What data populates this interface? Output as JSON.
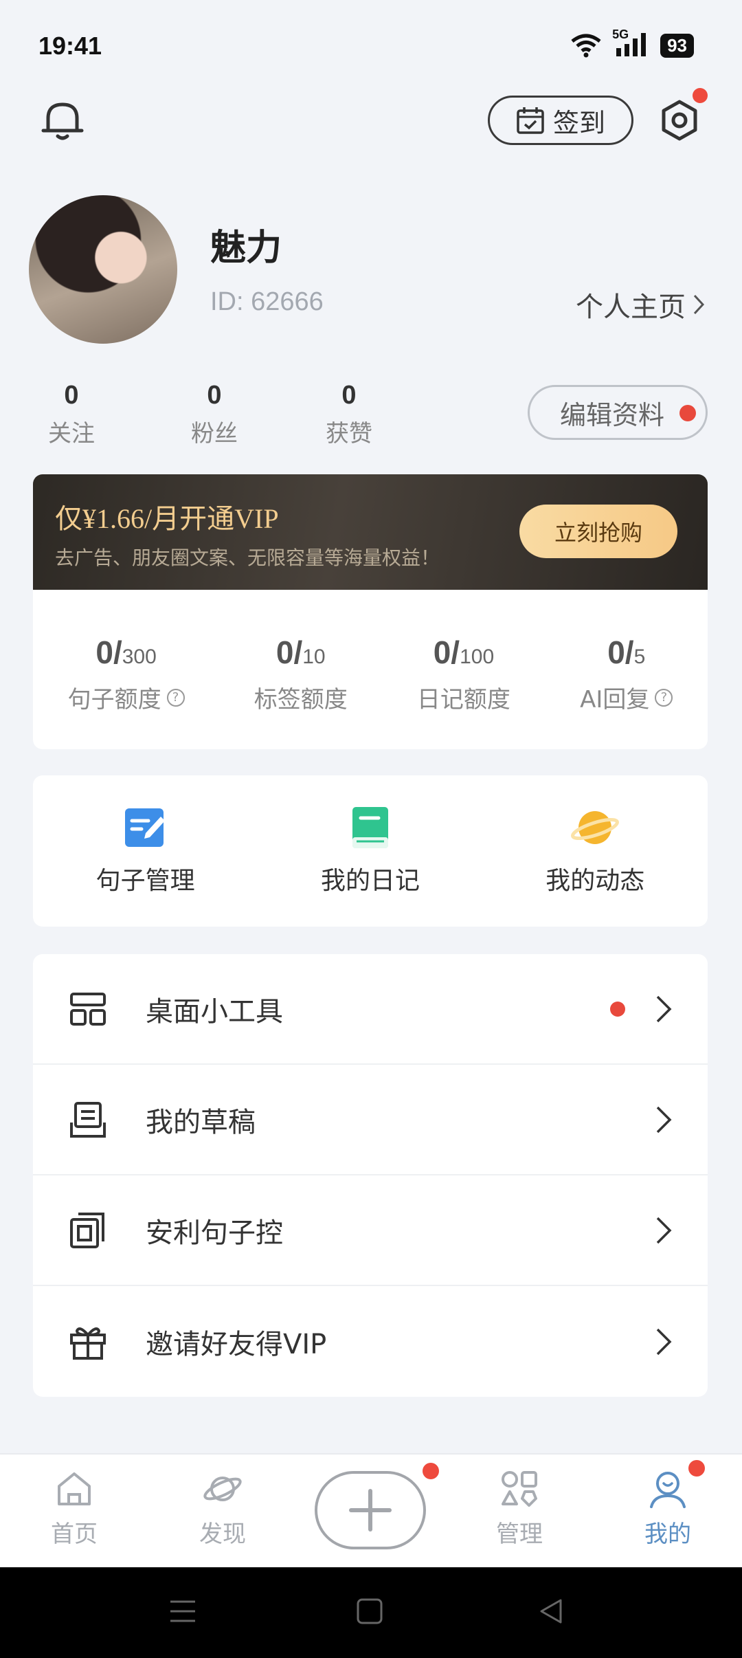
{
  "status_bar": {
    "time": "19:41",
    "network": "5G",
    "battery": "93"
  },
  "header": {
    "checkin_label": "签到"
  },
  "profile": {
    "name": "魅力",
    "id_text": "ID: 62666",
    "homepage_label": "个人主页",
    "stats": [
      {
        "value": "0",
        "label": "关注"
      },
      {
        "value": "0",
        "label": "粉丝"
      },
      {
        "value": "0",
        "label": "获赞"
      }
    ],
    "edit_label": "编辑资料"
  },
  "vip": {
    "title": "仅¥1.66/月开通VIP",
    "subtitle": "去广告、朋友圈文案、无限容量等海量权益！",
    "buy_label": "立刻抢购",
    "quotas": [
      {
        "used": "0/",
        "total": "300",
        "label": "句子额度"
      },
      {
        "used": "0/",
        "total": "10",
        "label": "标签额度"
      },
      {
        "used": "0/",
        "total": "100",
        "label": "日记额度"
      },
      {
        "used": "0/",
        "total": "5",
        "label": "AI回复"
      }
    ]
  },
  "shortcuts": [
    {
      "label": "句子管理",
      "icon": "edit-note-icon"
    },
    {
      "label": "我的日记",
      "icon": "diary-book-icon"
    },
    {
      "label": "我的动态",
      "icon": "planet-icon"
    }
  ],
  "menu": [
    {
      "label": "桌面小工具",
      "icon": "widget-icon"
    },
    {
      "label": "我的草稿",
      "icon": "draft-icon"
    },
    {
      "label": "安利句子控",
      "icon": "share-icon"
    },
    {
      "label": "邀请好友得VIP",
      "icon": "gift-icon"
    }
  ],
  "bottom_nav": [
    {
      "label": "首页",
      "icon": "home-icon"
    },
    {
      "label": "发现",
      "icon": "discover-icon"
    },
    {
      "label": "管理",
      "icon": "manage-icon"
    },
    {
      "label": "我的",
      "icon": "profile-icon",
      "active": true
    }
  ],
  "colors": {
    "accent": "#5c8fc3",
    "badge": "#ee4a3d",
    "vip_gold": "#f3cd8f",
    "background": "#f2f4f8"
  }
}
